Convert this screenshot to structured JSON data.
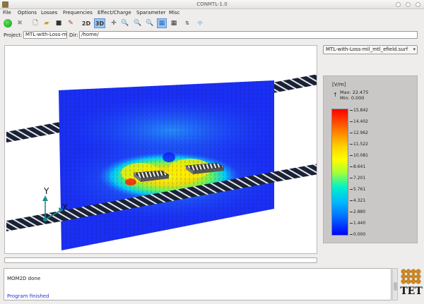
{
  "window": {
    "title": "CONMTL-1.0"
  },
  "menu": [
    "File",
    "Options",
    "Losses",
    "Frequencies",
    "Effect/Charge",
    "Sparameter",
    "Misc"
  ],
  "toolbar": {
    "view2d_label": "2D",
    "view3d_label": "3D",
    "icons": [
      "run-icon",
      "stop-icon",
      "new-file-icon",
      "open-folder-icon",
      "save-icon",
      "edit-icon",
      "2d-view-icon",
      "3d-view-icon",
      "move-icon",
      "zoom-in-icon",
      "zoom-out-icon",
      "zoom-fit-icon",
      "field-plot-icon",
      "grid-icon",
      "flip-icon",
      "axis-icon"
    ]
  },
  "project": {
    "project_label": "Project:",
    "project_value": "MTL-with-Loss-mil",
    "dir_label": "Dir:",
    "dir_value": "/home/"
  },
  "surface_select": {
    "value": "MTL-with-Loss-mil_mtl_efield.surf"
  },
  "legend": {
    "unit": "[V/m]",
    "max_label": "Max:",
    "max_value": "22.475",
    "min_label": "Min:",
    "min_value": "0.000",
    "ticks": [
      "15.842",
      "14.402",
      "12.962",
      "11.522",
      "10.081",
      "8.641",
      "7.201",
      "5.761",
      "4.321",
      "2.880",
      "1.440",
      "0.000"
    ]
  },
  "axes": {
    "y": "Y",
    "x": "X"
  },
  "progress": {
    "value": 0
  },
  "console": {
    "line1": "MOM2D done",
    "line2": "Program finished"
  },
  "logo": {
    "text": "TET"
  },
  "colors": {
    "field_low": "#0000ff",
    "field_high": "#ff0000",
    "run_button": "#1fb51f",
    "accent": "#5a8fd0"
  }
}
